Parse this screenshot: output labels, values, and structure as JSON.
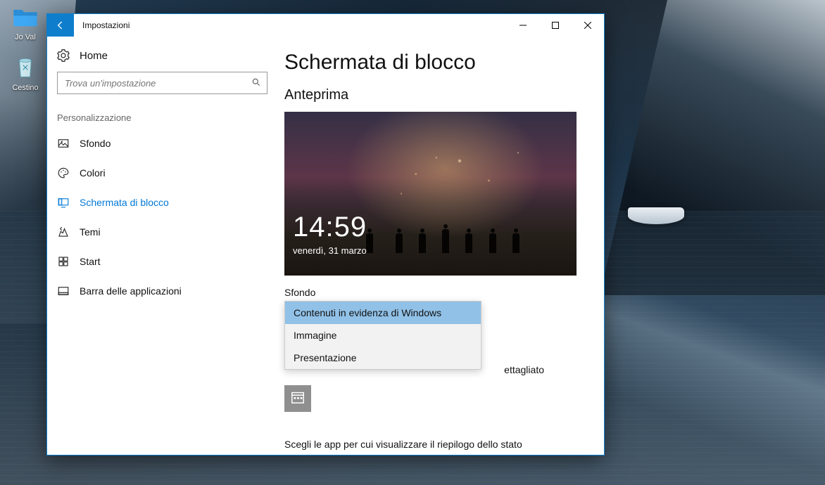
{
  "desktop": {
    "icons": {
      "user": "Jo Val",
      "recycle": "Cestino"
    }
  },
  "window": {
    "title": "Impostazioni"
  },
  "sidebar": {
    "home": "Home",
    "search_placeholder": "Trova un'impostazione",
    "section": "Personalizzazione",
    "items": [
      {
        "label": "Sfondo"
      },
      {
        "label": "Colori"
      },
      {
        "label": "Schermata di blocco"
      },
      {
        "label": "Temi"
      },
      {
        "label": "Start"
      },
      {
        "label": "Barra delle applicazioni"
      }
    ],
    "active_index": 2
  },
  "page": {
    "title": "Schermata di blocco",
    "preview_heading": "Anteprima",
    "preview_time": "14:59",
    "preview_date": "venerdì, 31 marzo",
    "background_label": "Sfondo",
    "dropdown": {
      "options": [
        "Contenuti in evidenza di Windows",
        "Immagine",
        "Presentazione"
      ],
      "selected_index": 0
    },
    "detail_suffix": "ettagliato",
    "summary": "Scegli le app per cui visualizzare il riepilogo dello stato"
  }
}
